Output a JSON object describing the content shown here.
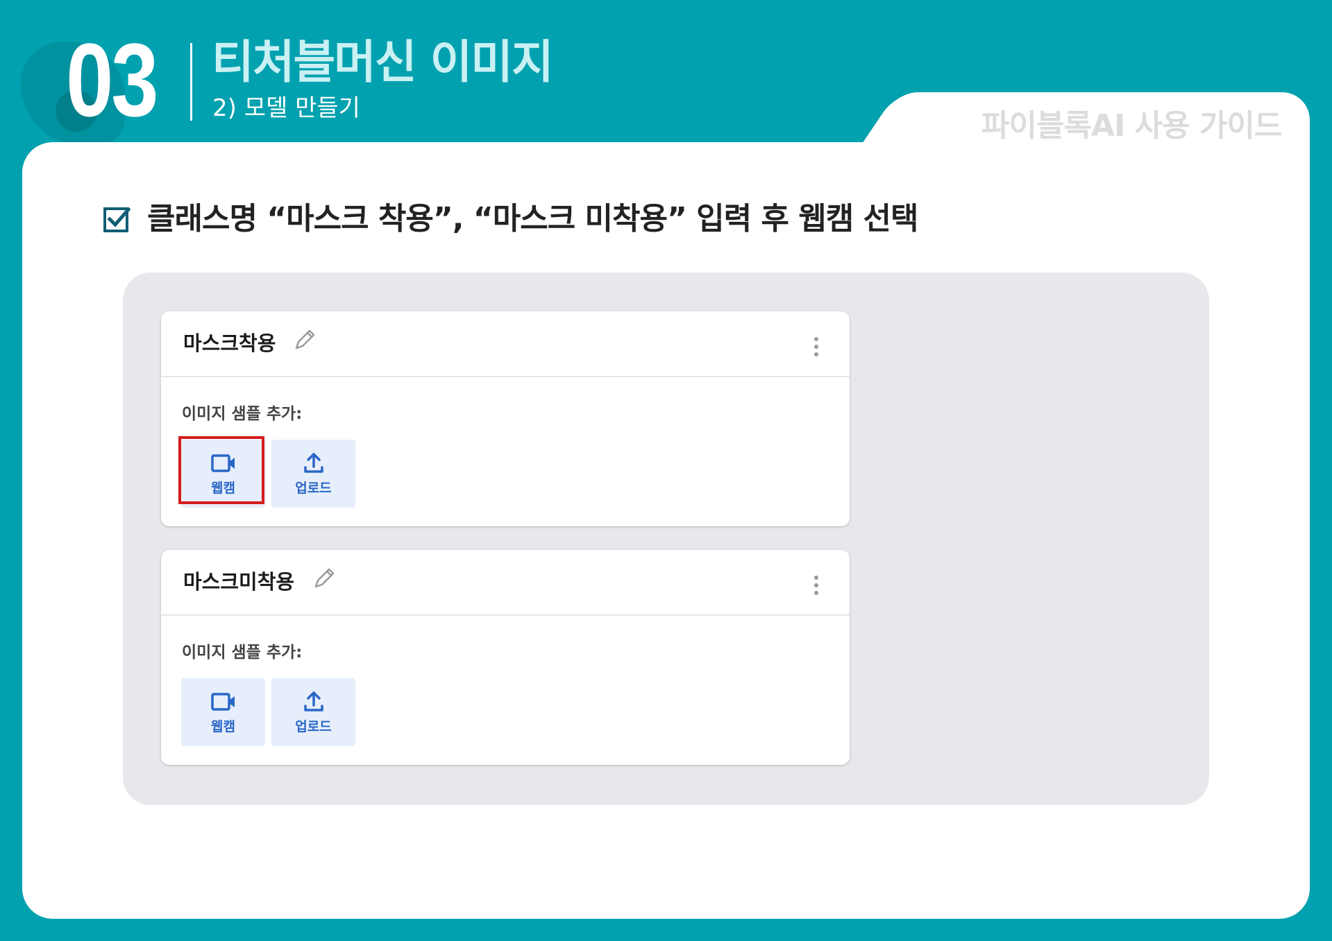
{
  "header": {
    "section_number": "03",
    "title": "티처블머신 이미지",
    "subtitle": "2) 모델 만들기",
    "guide_label": "파이블록AI 사용 가이드"
  },
  "instruction": {
    "text": "클래스명 “마스크 착용”, “마스크 미착용” 입력 후 웹캠 선택"
  },
  "classes": [
    {
      "name": "마스크착용",
      "sample_label": "이미지 샘플 추가:",
      "webcam_label": "웹캠",
      "upload_label": "업로드"
    },
    {
      "name": "마스크미착용",
      "sample_label": "이미지 샘플 추가:",
      "webcam_label": "웹캠",
      "upload_label": "업로드"
    }
  ],
  "colors": {
    "background": "#01a1af",
    "accent_blue": "#2966c6",
    "button_bg": "#e6eefb",
    "highlight": "#d51c1c"
  },
  "icons": [
    "check-square-icon",
    "pencil-icon",
    "more-vertical-icon",
    "video-camera-icon",
    "upload-icon"
  ]
}
